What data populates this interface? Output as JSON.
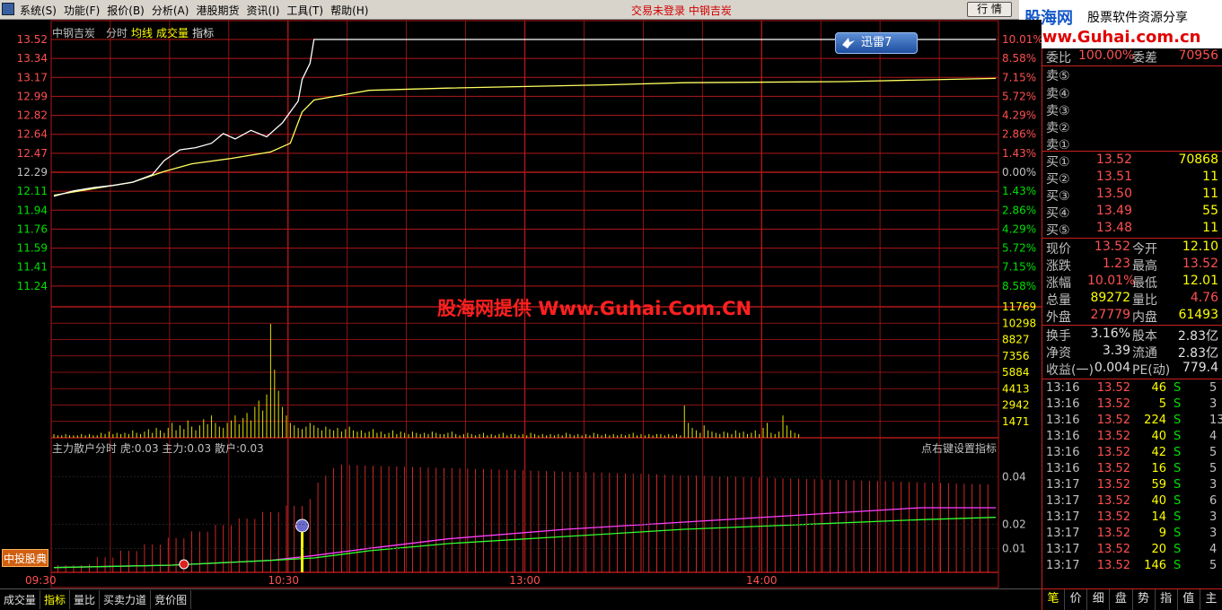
{
  "menubar": {
    "items": [
      "系统(S)",
      "功能(F)",
      "报价(B)",
      "分析(A)",
      "港股期货",
      "资讯(I)",
      "工具(T)",
      "帮助(H)"
    ],
    "status": "交易未登录  中钢吉炭",
    "hq_button": "行 情"
  },
  "brand": {
    "line1": "股海网",
    "line2": "股票软件资源分享",
    "line3": "Www.Guhai.com.cn"
  },
  "chart": {
    "stock_name": "中钢吉炭",
    "tabs": [
      "分时",
      "均线",
      "成交量",
      "指标"
    ],
    "watermark": "股海网提供 Www.Guhai.Com.CN",
    "xunlei_label": "迅雷7",
    "indicator_header": "主力散户分时 虎:0.03  主力:0.03  散户:0.03",
    "indicator_hint": "点右键设置指标",
    "broker_badge": "中投股典"
  },
  "chart_data": {
    "type": "line",
    "price_axis": [
      "13.52",
      "13.34",
      "13.17",
      "12.99",
      "12.82",
      "12.64",
      "12.47",
      "12.29",
      "12.11",
      "11.94",
      "11.76",
      "11.59",
      "11.41",
      "11.24"
    ],
    "pct_axis": [
      "10.01%",
      "8.58%",
      "7.15%",
      "5.72%",
      "4.29%",
      "2.86%",
      "1.43%",
      "0.00%",
      "1.43%",
      "2.86%",
      "4.29%",
      "5.72%",
      "7.15%",
      "8.58%"
    ],
    "volume_axis": [
      "11769",
      "10298",
      "8827",
      "7356",
      "5884",
      "4413",
      "2942",
      "1471"
    ],
    "indicator_axis": [
      "0.04",
      "0.02",
      "0.01"
    ],
    "time_axis": [
      "09:30",
      "10:30",
      "13:00",
      "14:00"
    ],
    "ylim": [
      11.24,
      13.52
    ],
    "prev_close": 12.29,
    "price_series": [
      [
        0,
        12.07
      ],
      [
        5,
        12.12
      ],
      [
        10,
        12.15
      ],
      [
        15,
        12.17
      ],
      [
        20,
        12.2
      ],
      [
        25,
        12.27
      ],
      [
        28,
        12.4
      ],
      [
        32,
        12.5
      ],
      [
        36,
        12.52
      ],
      [
        40,
        12.56
      ],
      [
        43,
        12.65
      ],
      [
        46,
        12.6
      ],
      [
        50,
        12.68
      ],
      [
        54,
        12.62
      ],
      [
        58,
        12.75
      ],
      [
        60,
        12.85
      ],
      [
        62,
        12.95
      ],
      [
        63,
        13.15
      ],
      [
        65,
        13.3
      ],
      [
        66,
        13.52
      ],
      [
        160,
        13.52
      ],
      [
        239,
        13.52
      ]
    ],
    "avg_series": [
      [
        0,
        12.08
      ],
      [
        10,
        12.14
      ],
      [
        20,
        12.2
      ],
      [
        28,
        12.3
      ],
      [
        35,
        12.37
      ],
      [
        45,
        12.42
      ],
      [
        55,
        12.48
      ],
      [
        60,
        12.56
      ],
      [
        63,
        12.85
      ],
      [
        66,
        12.96
      ],
      [
        80,
        13.05
      ],
      [
        100,
        13.07
      ],
      [
        140,
        13.1
      ],
      [
        160,
        13.12
      ],
      [
        200,
        13.13
      ],
      [
        239,
        13.16
      ]
    ],
    "volume": [
      3,
      2,
      2,
      3,
      2,
      2,
      2,
      3,
      2,
      3,
      2,
      2,
      4,
      3,
      5,
      3,
      4,
      3,
      4,
      3,
      6,
      4,
      3,
      5,
      7,
      4,
      8,
      6,
      4,
      8,
      12,
      6,
      10,
      7,
      14,
      9,
      6,
      10,
      15,
      11,
      18,
      12,
      9,
      8,
      12,
      14,
      18,
      11,
      16,
      20,
      14,
      25,
      30,
      22,
      35,
      92,
      55,
      38,
      25,
      18,
      12,
      10,
      8,
      7,
      9,
      12,
      10,
      8,
      6,
      9,
      7,
      6,
      8,
      5,
      7,
      9,
      6,
      5,
      6,
      4,
      5,
      7,
      4,
      5,
      3,
      4,
      6,
      3,
      5,
      4,
      3,
      5,
      4,
      3,
      4,
      3,
      5,
      4,
      3,
      3,
      4,
      5,
      3,
      2,
      3,
      4,
      3,
      2,
      3,
      4,
      2,
      3,
      2,
      3,
      4,
      2,
      3,
      3,
      2,
      3,
      2,
      4,
      3,
      2,
      3,
      2,
      3,
      2,
      3,
      2,
      4,
      3,
      2,
      3,
      2,
      3,
      2,
      4,
      3,
      2,
      3,
      2,
      3,
      2,
      3,
      2,
      3,
      4,
      2,
      3,
      2,
      3,
      2,
      3,
      3,
      2,
      3,
      2,
      3,
      2,
      26,
      12,
      8,
      6,
      4,
      10,
      6,
      5,
      4,
      3,
      5,
      4,
      3,
      6,
      4,
      5,
      3,
      4,
      6,
      3,
      8,
      12,
      4,
      3,
      5,
      18,
      10,
      6,
      4,
      3
    ],
    "main_line": [
      [
        0,
        0.002
      ],
      [
        30,
        0.003
      ],
      [
        55,
        0.005
      ],
      [
        66,
        0.007
      ],
      [
        80,
        0.01
      ],
      [
        100,
        0.014
      ],
      [
        130,
        0.018
      ],
      [
        160,
        0.021
      ],
      [
        190,
        0.024
      ],
      [
        220,
        0.027
      ],
      [
        239,
        0.027
      ]
    ],
    "retail_line": [
      [
        0,
        0.002
      ],
      [
        30,
        0.003
      ],
      [
        55,
        0.005
      ],
      [
        66,
        0.006
      ],
      [
        80,
        0.009
      ],
      [
        100,
        0.012
      ],
      [
        130,
        0.015
      ],
      [
        160,
        0.018
      ],
      [
        190,
        0.02
      ],
      [
        220,
        0.022
      ],
      [
        239,
        0.023
      ]
    ]
  },
  "quote": {
    "ratio_label": "委比",
    "ratio_value": "100.00%",
    "diff_label": "委差",
    "diff_value": "70956",
    "sells": [
      "卖⑤",
      "卖④",
      "卖③",
      "卖②",
      "卖①"
    ],
    "buys": [
      {
        "label": "买①",
        "price": "13.52",
        "vol": "70868"
      },
      {
        "label": "买②",
        "price": "13.51",
        "vol": "11"
      },
      {
        "label": "买③",
        "price": "13.50",
        "vol": "11"
      },
      {
        "label": "买④",
        "price": "13.49",
        "vol": "55"
      },
      {
        "label": "买⑤",
        "price": "13.48",
        "vol": "11"
      }
    ],
    "stats": [
      {
        "l1": "现价",
        "v1": "13.52",
        "l2": "今开",
        "v2": "12.10"
      },
      {
        "l1": "涨跌",
        "v1": "1.23",
        "l2": "最高",
        "v2": "13.52"
      },
      {
        "l1": "涨幅",
        "v1": "10.01%",
        "l2": "最低",
        "v2": "12.01"
      },
      {
        "l1": "总量",
        "v1": "89272",
        "l2": "量比",
        "v2": "4.76"
      },
      {
        "l1": "外盘",
        "v1": "27779",
        "l2": "内盘",
        "v2": "61493"
      }
    ],
    "stats2": [
      {
        "l1": "换手",
        "v1": "3.16%",
        "l2": "股本",
        "v2": "2.83亿"
      },
      {
        "l1": "净资",
        "v1": "3.39",
        "l2": "流通",
        "v2": "2.83亿"
      },
      {
        "l1": "收益(一)",
        "v1": "0.004",
        "l2": "PE(动)",
        "v2": "779.4"
      }
    ],
    "ticks": [
      {
        "time": "13:16",
        "price": "13.52",
        "vol": "46",
        "dir": "S",
        "n": "5"
      },
      {
        "time": "13:16",
        "price": "13.52",
        "vol": "5",
        "dir": "S",
        "n": "3"
      },
      {
        "time": "13:16",
        "price": "13.52",
        "vol": "224",
        "dir": "S",
        "n": "13"
      },
      {
        "time": "13:16",
        "price": "13.52",
        "vol": "40",
        "dir": "S",
        "n": "4"
      },
      {
        "time": "13:16",
        "price": "13.52",
        "vol": "42",
        "dir": "S",
        "n": "5"
      },
      {
        "time": "13:16",
        "price": "13.52",
        "vol": "16",
        "dir": "S",
        "n": "5"
      },
      {
        "time": "13:17",
        "price": "13.52",
        "vol": "59",
        "dir": "S",
        "n": "3"
      },
      {
        "time": "13:17",
        "price": "13.52",
        "vol": "40",
        "dir": "S",
        "n": "6"
      },
      {
        "time": "13:17",
        "price": "13.52",
        "vol": "14",
        "dir": "S",
        "n": "3"
      },
      {
        "time": "13:17",
        "price": "13.52",
        "vol": "9",
        "dir": "S",
        "n": "3"
      },
      {
        "time": "13:17",
        "price": "13.52",
        "vol": "20",
        "dir": "S",
        "n": "4"
      },
      {
        "time": "13:17",
        "price": "13.52",
        "vol": "146",
        "dir": "S",
        "n": "5"
      }
    ],
    "right_tabs": [
      "笔",
      "价",
      "细",
      "盘",
      "势",
      "指",
      "值",
      "主"
    ]
  },
  "bottom_tabs": [
    "成交量",
    "指标",
    "量比",
    "买卖力道",
    "竞价图"
  ],
  "colors": {
    "up": "#ff5050",
    "down": "#00e000",
    "grid": "#b01818",
    "price_line": "#ffffff",
    "avg_line": "#ffff60",
    "accent_yellow": "#ffff00"
  }
}
